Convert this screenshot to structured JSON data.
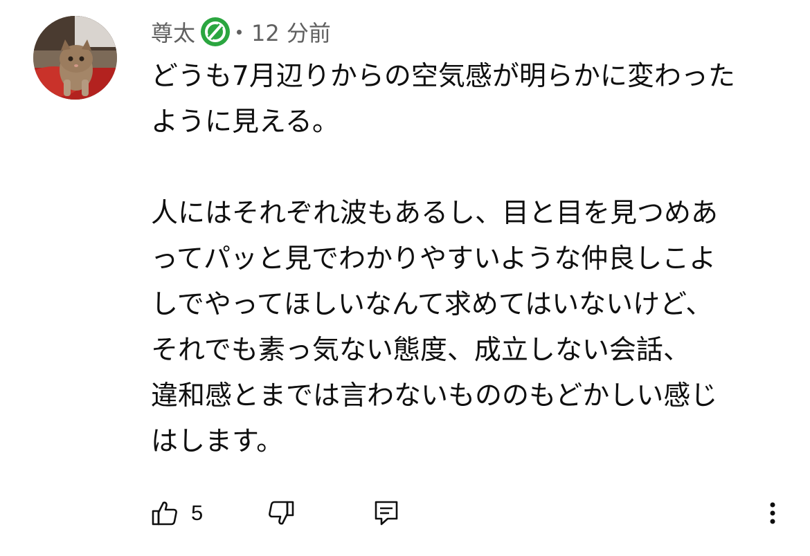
{
  "comment": {
    "author": "尊太",
    "badge_icon": "verified-channel-badge-icon",
    "badge_color": "#2ba640",
    "separator": "•",
    "timestamp": "12 分前",
    "lines": [
      "どうも7月辺りからの空気感が明らかに変わった",
      "ように見える。",
      "",
      "人にはそれぞれ波もあるし、目と目を見つめあ",
      "ってパッと見でわかりやすいような仲良しこよ",
      "しでやってほしいなんて求めてはいないけど、",
      "それでも素っ気ない態度、成立しない会話、",
      "違和感とまでは言わないもののもどかしい感じ",
      "はします。"
    ]
  },
  "actions": {
    "like_icon": "thumb-up-icon",
    "like_count": "5",
    "dislike_icon": "thumb-down-icon",
    "reply_icon": "reply-comment-icon",
    "more_icon": "more-vertical-icon"
  }
}
